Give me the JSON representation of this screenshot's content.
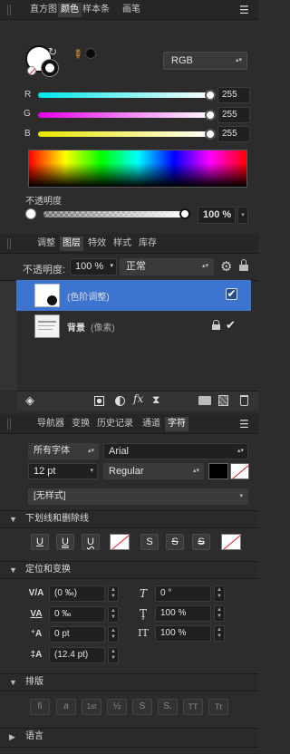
{
  "color_panel": {
    "tabs": [
      "直方图",
      "颜色",
      "样本条",
      "画笔"
    ],
    "active_tab": 1,
    "mode": "RGB",
    "channels": [
      {
        "label": "R",
        "value": "255",
        "level": 1.0
      },
      {
        "label": "G",
        "value": "255",
        "level": 1.0
      },
      {
        "label": "B",
        "value": "255",
        "level": 1.0
      }
    ],
    "opacity_label": "不透明度",
    "opacity_value": "100 %"
  },
  "layers_panel": {
    "tabs": [
      "调整",
      "图层",
      "特效",
      "样式",
      "库存"
    ],
    "active_tab": 1,
    "opacity_label": "不透明度:",
    "opacity_value": "100 %",
    "blend_mode": "正常",
    "layers": [
      {
        "name": "(色阶调整)",
        "selected": true,
        "checked": true,
        "locked": false
      },
      {
        "name": "背景",
        "type": "(像素)",
        "selected": false,
        "checked": true,
        "locked": true
      }
    ]
  },
  "character_panel": {
    "tabs": [
      "导航器",
      "变换",
      "历史记录",
      "通道",
      "字符"
    ],
    "active_tab": 4,
    "font_collection": "所有字体",
    "font_family": "Arial",
    "font_size": "12 pt",
    "font_style": "Regular",
    "style_preset": "[无样式]",
    "sections": {
      "underline": "下划线和删除线",
      "position": "定位和变换",
      "typography": "排版",
      "language": "语言"
    },
    "fields": {
      "tracking": "(0 ‰)",
      "kerning": "0 ‰",
      "baseline": "0 pt",
      "leading": "(12.4 pt)",
      "shear": "0 °",
      "vertical_scale": "100 %",
      "horizontal_scale": "100 %"
    },
    "typography_buttons": [
      "fi",
      "a",
      "1st",
      "½",
      "S",
      "S.",
      "TT",
      "Tt"
    ]
  },
  "colors": {
    "selection": "#3c74cf",
    "panel_bg": "#2c2c2c",
    "red": "#e0232b"
  }
}
